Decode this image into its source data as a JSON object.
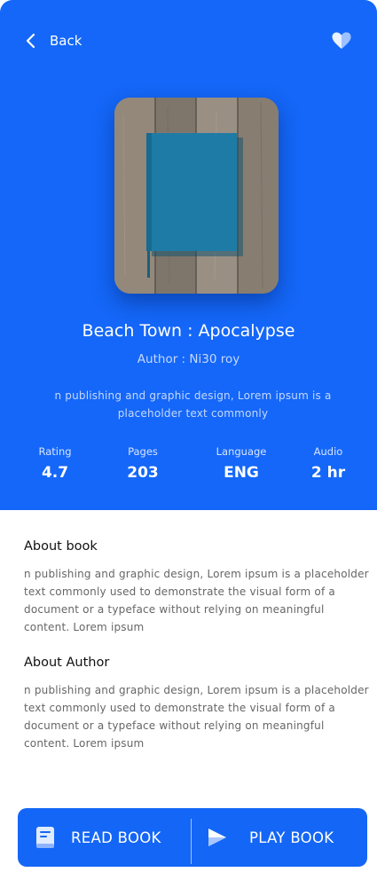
{
  "header": {
    "back_label": "Back"
  },
  "book": {
    "title": "Beach Town : Apocalypse",
    "author": "Author : Ni30 roy",
    "short_description": "n publishing and graphic design, Lorem ipsum is a placeholder text commonly"
  },
  "stats": [
    {
      "label": "Rating",
      "value": "4.7"
    },
    {
      "label": "Pages",
      "value": "203"
    },
    {
      "label": "Language",
      "value": "ENG"
    },
    {
      "label": "Audio",
      "value": "2 hr"
    }
  ],
  "about_book": {
    "heading": "About book",
    "text": "n publishing and graphic design, Lorem ipsum is a placeholder text commonly used to demonstrate the visual form of a document or a typeface without relying on meaningful content. Lorem ipsum"
  },
  "about_author": {
    "heading": "About Author",
    "text": "n publishing and graphic design, Lorem ipsum is a placeholder text commonly used to demonstrate the visual form of a document or a typeface without relying on meaningful content. Lorem ipsum"
  },
  "actions": {
    "read_label": "READ BOOK",
    "play_label": "PLAY BOOK"
  },
  "colors": {
    "primary": "#1467f8",
    "button_bar": "#1466f6",
    "book_cover": "#1e7ba6"
  },
  "icons": [
    "chevron-left-icon",
    "heart-icon",
    "book-icon",
    "play-icon"
  ]
}
